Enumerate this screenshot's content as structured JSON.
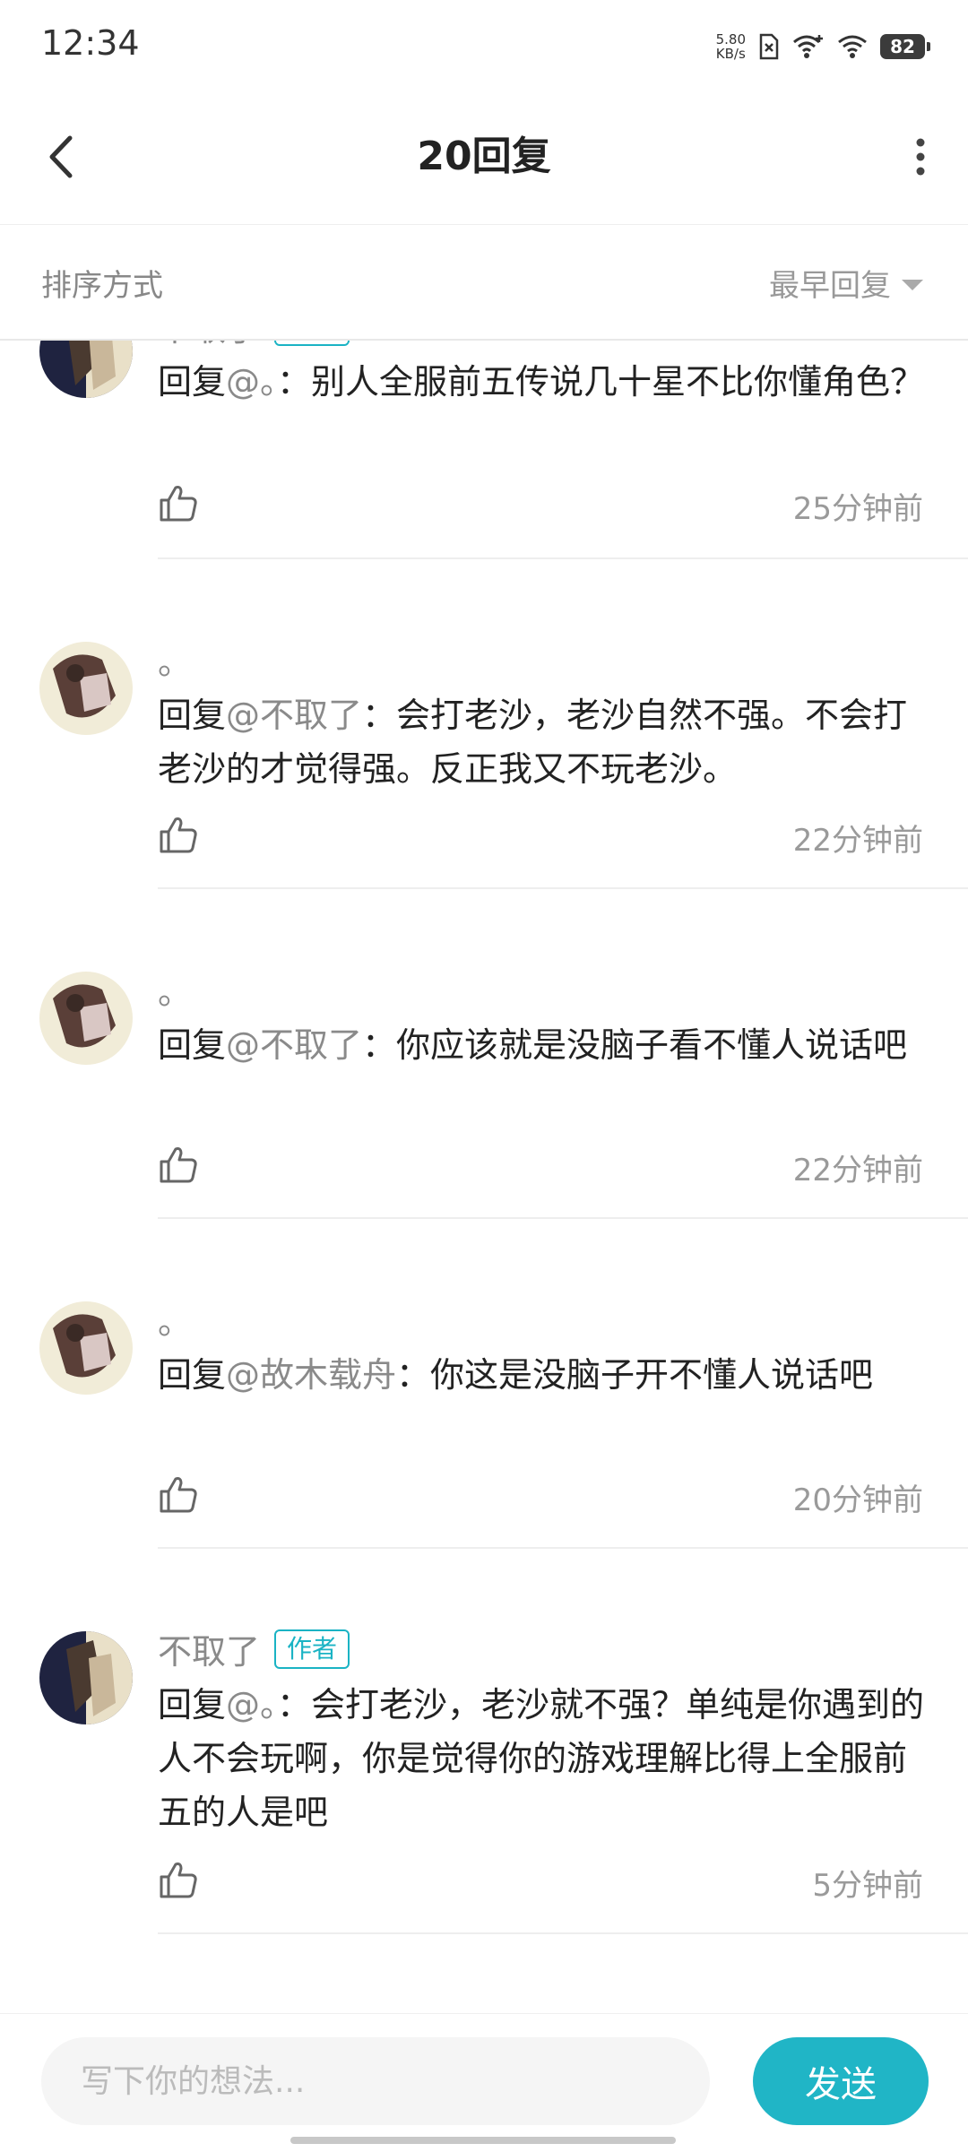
{
  "status_bar": {
    "time": "12:34",
    "net_speed_value": "5.80",
    "net_speed_unit": "KB/s",
    "battery": "82"
  },
  "header": {
    "title": "20回复"
  },
  "sort_bar": {
    "label": "排序方式",
    "selected": "最早回复"
  },
  "comments": [
    {
      "author": "不取了",
      "badge": "作者",
      "reply_prefix": "回复",
      "mention": "@。",
      "separator": "：",
      "body": "别人全服前五传说几十星不比你懂角色？",
      "time": "25分钟前"
    },
    {
      "author": "。",
      "badge": "",
      "reply_prefix": "回复",
      "mention": "@不取了",
      "separator": "：",
      "body": "会打老沙，老沙自然不强。不会打老沙的才觉得强。反正我又不玩老沙。",
      "time": "22分钟前"
    },
    {
      "author": "。",
      "badge": "",
      "reply_prefix": "回复",
      "mention": "@不取了",
      "separator": "：",
      "body": "你应该就是没脑子看不懂人说话吧",
      "time": "22分钟前"
    },
    {
      "author": "。",
      "badge": "",
      "reply_prefix": "回复",
      "mention": "@故木载舟",
      "separator": "：",
      "body": "你这是没脑子开不懂人说话吧",
      "time": "20分钟前"
    },
    {
      "author": "不取了",
      "badge": "作者",
      "reply_prefix": "回复",
      "mention": "@。",
      "separator": "：",
      "body": "会打老沙，老沙就不强？单纯是你遇到的人不会玩啊，你是觉得你的游戏理解比得上全服前五的人是吧",
      "time": "5分钟前"
    }
  ],
  "input_bar": {
    "placeholder": "写下你的想法...",
    "send_label": "发送"
  },
  "colors": {
    "accent": "#20b5c6",
    "badge": "#1ab3c4"
  }
}
